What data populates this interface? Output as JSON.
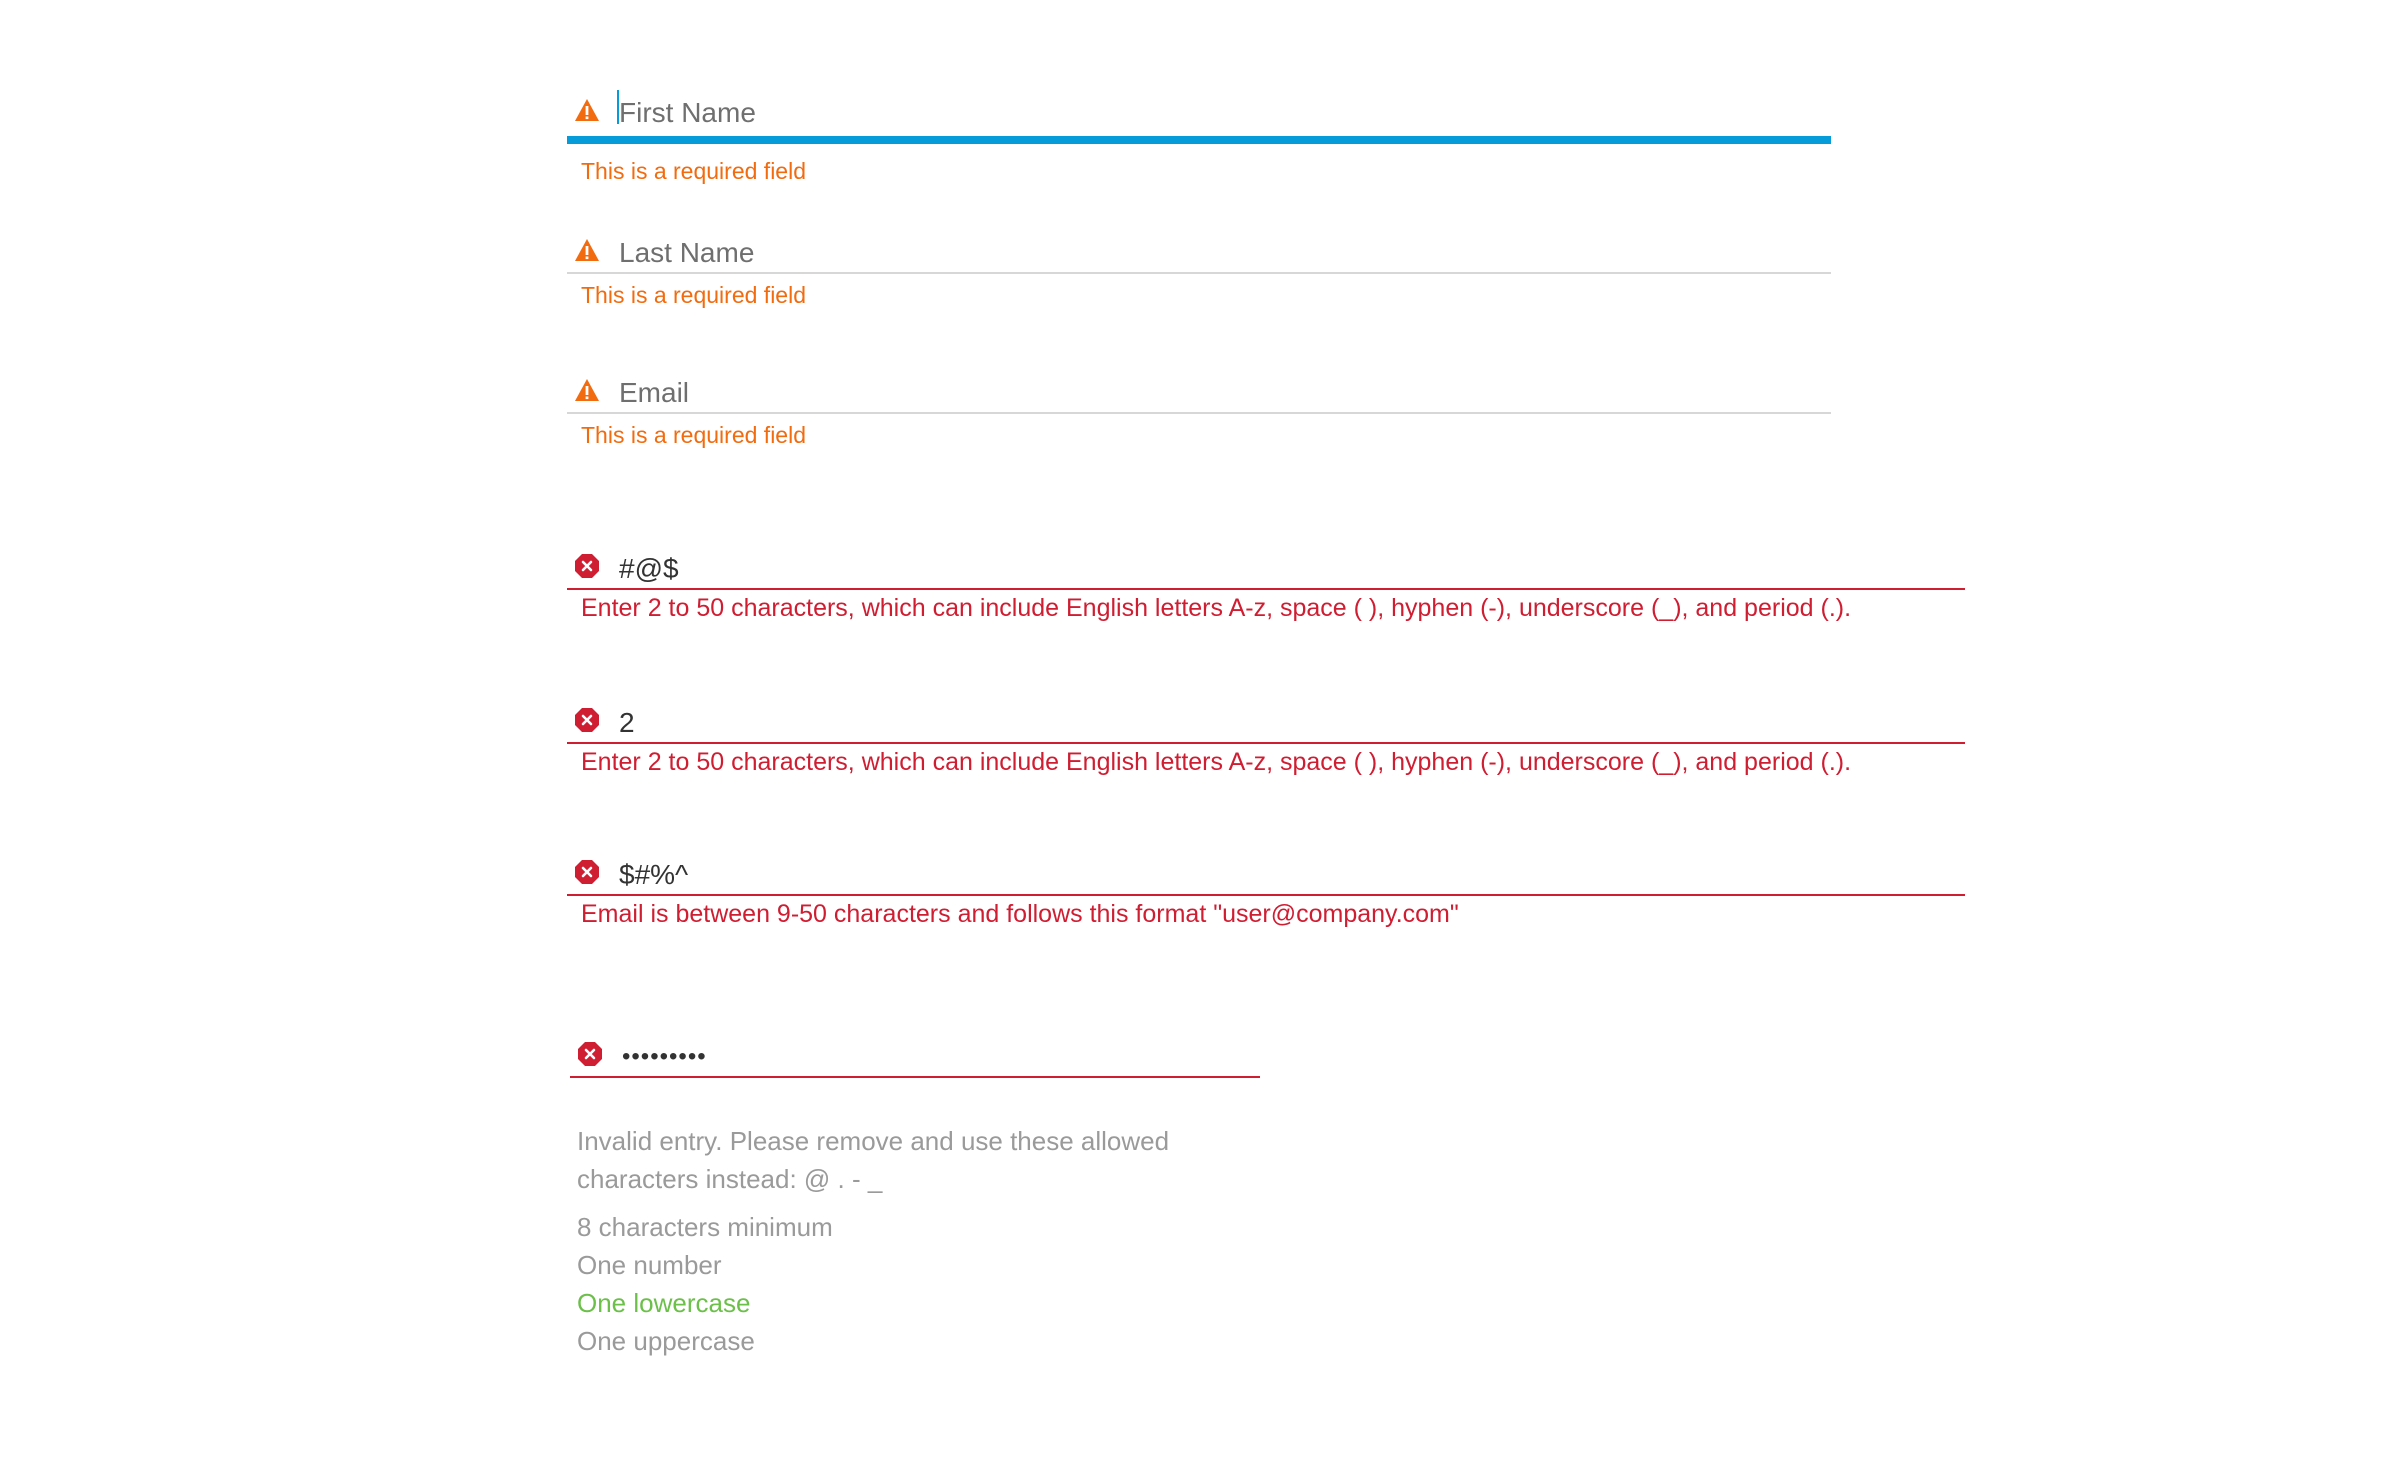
{
  "colors": {
    "warning": "#f26b0f",
    "error": "#cf1d32",
    "focus": "#069bd9",
    "success": "#6cc04a",
    "muted": "#9a9a9a"
  },
  "required_fields": [
    {
      "placeholder": "First Name",
      "value": "",
      "message": "This is a required field",
      "icon": "warning-triangle-icon"
    },
    {
      "placeholder": "Last Name",
      "value": "",
      "message": "This is a required field",
      "icon": "warning-triangle-icon"
    },
    {
      "placeholder": "Email",
      "value": "",
      "message": "This is a required field",
      "icon": "warning-triangle-icon"
    }
  ],
  "invalid_fields": [
    {
      "value": "#@$",
      "message": "Enter 2 to 50 characters, which can include English letters A-z, space ( ), hyphen (-), underscore (_), and period (.).",
      "icon": "error-x-octagon-icon"
    },
    {
      "value": "2",
      "message": "Enter 2 to 50 characters, which can include English letters A-z, space ( ), hyphen (-), underscore (_), and period (.).",
      "icon": "error-x-octagon-icon"
    },
    {
      "value": "$#%^",
      "message": "Email is between 9-50 characters and follows this format \"user@company.com\"",
      "icon": "error-x-octagon-icon"
    }
  ],
  "password": {
    "value": "•••••••••",
    "icon": "error-x-octagon-icon",
    "invalid_message_line1": "Invalid entry. Please remove and use these allowed",
    "invalid_message_line2": "characters instead: @ . - _",
    "rules": [
      {
        "label": "8 characters minimum",
        "met": false
      },
      {
        "label": "One number",
        "met": false
      },
      {
        "label": "One lowercase",
        "met": true
      },
      {
        "label": "One uppercase",
        "met": false
      }
    ]
  }
}
